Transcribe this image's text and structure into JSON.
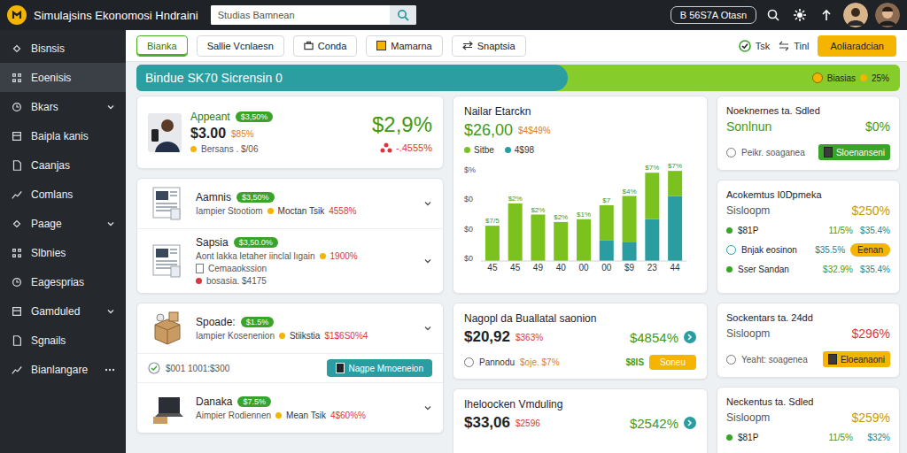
{
  "header": {
    "title": "Simulajsins Ekonomosi Hndraini",
    "search_placeholder": "Studias Bamnean",
    "account": "B 56S7A Otasn"
  },
  "sidebar": {
    "items": [
      {
        "label": "Bisnsis",
        "selected": false,
        "kind": "plain"
      },
      {
        "label": "Eoenisis",
        "selected": true,
        "kind": "plain"
      },
      {
        "label": "Bkars",
        "selected": false,
        "kind": "group"
      },
      {
        "label": "Baipla kanis",
        "selected": false,
        "kind": "plain"
      },
      {
        "label": "Caanjas",
        "selected": false,
        "kind": "plain"
      },
      {
        "label": "Comlans",
        "selected": false,
        "kind": "plain"
      },
      {
        "label": "Paage",
        "selected": false,
        "kind": "group"
      },
      {
        "label": "Slbnies",
        "selected": false,
        "kind": "plain"
      },
      {
        "label": "Eagesprias",
        "selected": false,
        "kind": "plain"
      },
      {
        "label": "Gamduled",
        "selected": false,
        "kind": "group"
      },
      {
        "label": "Sgnails",
        "selected": false,
        "kind": "plain"
      },
      {
        "label": "Bianlangare",
        "selected": false,
        "kind": "more"
      }
    ]
  },
  "toolbar": {
    "tabs": [
      {
        "label": "Bianka",
        "selected": true
      },
      {
        "label": "Sallie Vcnlaesn",
        "selected": false
      },
      {
        "label": "Conda",
        "selected": false
      },
      {
        "label": "Mamarna",
        "selected": false
      },
      {
        "label": "Snaptsia",
        "selected": false
      }
    ],
    "actions": [
      {
        "label": "Tsk"
      },
      {
        "label": "Tinl"
      }
    ],
    "primary_button": "Aoliaradcian"
  },
  "banner": {
    "title": "Bindue SK70 Sicrensin 0",
    "tag": "Biasias",
    "value": "25%"
  },
  "overview": {
    "name": "Appeant",
    "badge": "$3,50%",
    "amount": "$3.00",
    "change": "$85%",
    "note": "Bersans . $/06",
    "value": "$2,9%",
    "delta": "-.4555%"
  },
  "holdings": [
    {
      "name": "Aamnis",
      "badge": "$3,50%",
      "detail": "Iampier Stootiom",
      "tag": "Moctan Tsik",
      "pct": "4558%"
    },
    {
      "name": "Sapsia",
      "badge": "$3,50.0%",
      "detail": "Aont lakka letaher iinclal lıgain",
      "pct": "1900%",
      "extra": "Cemaaokssion",
      "note": "bosasia. $4175"
    }
  ],
  "shipments": [
    {
      "name": "Spoade:",
      "badge": "$1.5%",
      "detail": "Iampier Kosenenion",
      "tag": "Stiikstia",
      "pct": "$1$6S0%4",
      "check": "$001 1001:$300",
      "button": "Nagpe Mmoeneion"
    },
    {
      "name": "Danaka",
      "badge": "$7.5%",
      "detail": "Aimpier Rodiennen",
      "tag": "Mean Tsik",
      "pct": "4$60%%"
    }
  ],
  "chart": {
    "title": "Nailar Etarckn",
    "value": "$26,00",
    "change": "$4$49%",
    "y_ticks": [
      "$%",
      "$0",
      "$0",
      "$0"
    ],
    "x_labels": [
      "45",
      "45",
      "49",
      "40",
      "00",
      "00",
      "$9",
      "23",
      "44"
    ],
    "bar_labels": [
      "$7/5",
      "$2%",
      "$2%",
      "$2%",
      "$1%",
      "$7",
      "$4%",
      "$7%",
      "$7%"
    ],
    "series": [
      {
        "name": "Sitbe",
        "color": "#7cc21f",
        "values": [
          38,
          62,
          50,
          42,
          45,
          38,
          50,
          50,
          27
        ]
      },
      {
        "name": "4$98",
        "color": "#2a9da0",
        "values": [
          0,
          0,
          0,
          0,
          0,
          22,
          20,
          45,
          70
        ]
      }
    ]
  },
  "summaries": [
    {
      "title": "Nagopl da Buallatal saonion",
      "amount": "$20,92",
      "change": "$363%",
      "value": "$4854%",
      "row": {
        "label": "Pannodu",
        "detail": "$oje. $7%",
        "code": "$8IS",
        "button": "Soneu"
      }
    },
    {
      "title": "Iheloocken Vmduling",
      "amount": "$33,06",
      "change": "$2596",
      "value": "$2542%"
    }
  ],
  "side_cards": [
    {
      "title": "Noeknernes ta. Sdled",
      "subtitle": "Sonlnun",
      "value": "$0%",
      "color": "#3f9a12",
      "action": {
        "label": "Peikr. soaganea",
        "button": "Sloenanseni",
        "style": "green"
      }
    },
    {
      "title": "Acokemtus I0Dpmeka",
      "subtitle": "Sisloopm",
      "value": "$250%",
      "color": "#c99a00",
      "rows": [
        {
          "kind": "dot",
          "label": "$81P",
          "share": "11/5%",
          "value": "$35.4%"
        },
        {
          "kind": "ring",
          "label": "Bnjak eosinon",
          "share": "$35.5%",
          "button": "Eenan"
        },
        {
          "kind": "dot",
          "label": "Sser Sandan",
          "share": "$32.9%",
          "value": "$35.4%"
        }
      ]
    },
    {
      "title": "Sockentars ta. 24dd",
      "subtitle": "Sisloopm",
      "value": "$296%",
      "color": "#d9363e",
      "action": {
        "label": "Yeaht: soagenea",
        "button": "Eloeanaoni",
        "style": "yellow"
      }
    },
    {
      "title": "Neckentus ta. Sdled",
      "subtitle": "Sisloopm",
      "value": "$259%",
      "color": "#c99a00",
      "rows": [
        {
          "kind": "dot",
          "label": "$81P",
          "share": "11/5%",
          "value": "$32%"
        }
      ]
    }
  ]
}
